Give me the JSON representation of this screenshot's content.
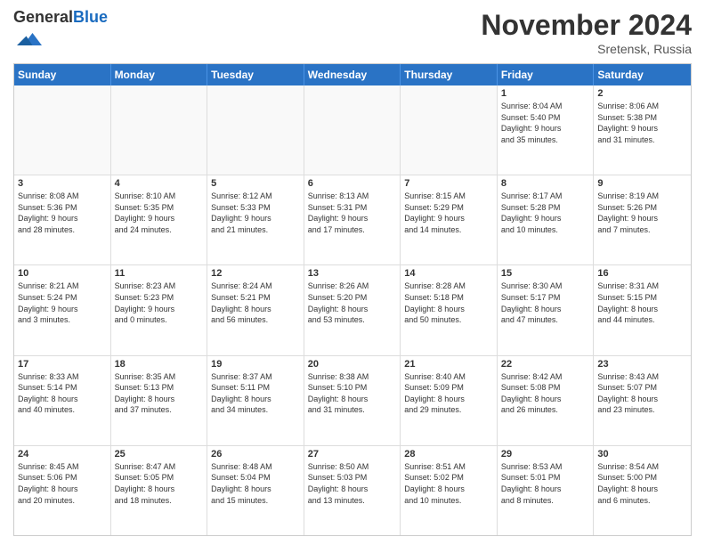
{
  "logo": {
    "general": "General",
    "blue": "Blue"
  },
  "header": {
    "month": "November 2024",
    "location": "Sretensk, Russia"
  },
  "weekdays": [
    "Sunday",
    "Monday",
    "Tuesday",
    "Wednesday",
    "Thursday",
    "Friday",
    "Saturday"
  ],
  "rows": [
    [
      {
        "day": "",
        "empty": true
      },
      {
        "day": "",
        "empty": true
      },
      {
        "day": "",
        "empty": true
      },
      {
        "day": "",
        "empty": true
      },
      {
        "day": "",
        "empty": true
      },
      {
        "day": "1",
        "lines": [
          "Sunrise: 8:04 AM",
          "Sunset: 5:40 PM",
          "Daylight: 9 hours",
          "and 35 minutes."
        ]
      },
      {
        "day": "2",
        "lines": [
          "Sunrise: 8:06 AM",
          "Sunset: 5:38 PM",
          "Daylight: 9 hours",
          "and 31 minutes."
        ]
      }
    ],
    [
      {
        "day": "3",
        "lines": [
          "Sunrise: 8:08 AM",
          "Sunset: 5:36 PM",
          "Daylight: 9 hours",
          "and 28 minutes."
        ]
      },
      {
        "day": "4",
        "lines": [
          "Sunrise: 8:10 AM",
          "Sunset: 5:35 PM",
          "Daylight: 9 hours",
          "and 24 minutes."
        ]
      },
      {
        "day": "5",
        "lines": [
          "Sunrise: 8:12 AM",
          "Sunset: 5:33 PM",
          "Daylight: 9 hours",
          "and 21 minutes."
        ]
      },
      {
        "day": "6",
        "lines": [
          "Sunrise: 8:13 AM",
          "Sunset: 5:31 PM",
          "Daylight: 9 hours",
          "and 17 minutes."
        ]
      },
      {
        "day": "7",
        "lines": [
          "Sunrise: 8:15 AM",
          "Sunset: 5:29 PM",
          "Daylight: 9 hours",
          "and 14 minutes."
        ]
      },
      {
        "day": "8",
        "lines": [
          "Sunrise: 8:17 AM",
          "Sunset: 5:28 PM",
          "Daylight: 9 hours",
          "and 10 minutes."
        ]
      },
      {
        "day": "9",
        "lines": [
          "Sunrise: 8:19 AM",
          "Sunset: 5:26 PM",
          "Daylight: 9 hours",
          "and 7 minutes."
        ]
      }
    ],
    [
      {
        "day": "10",
        "lines": [
          "Sunrise: 8:21 AM",
          "Sunset: 5:24 PM",
          "Daylight: 9 hours",
          "and 3 minutes."
        ]
      },
      {
        "day": "11",
        "lines": [
          "Sunrise: 8:23 AM",
          "Sunset: 5:23 PM",
          "Daylight: 9 hours",
          "and 0 minutes."
        ]
      },
      {
        "day": "12",
        "lines": [
          "Sunrise: 8:24 AM",
          "Sunset: 5:21 PM",
          "Daylight: 8 hours",
          "and 56 minutes."
        ]
      },
      {
        "day": "13",
        "lines": [
          "Sunrise: 8:26 AM",
          "Sunset: 5:20 PM",
          "Daylight: 8 hours",
          "and 53 minutes."
        ]
      },
      {
        "day": "14",
        "lines": [
          "Sunrise: 8:28 AM",
          "Sunset: 5:18 PM",
          "Daylight: 8 hours",
          "and 50 minutes."
        ]
      },
      {
        "day": "15",
        "lines": [
          "Sunrise: 8:30 AM",
          "Sunset: 5:17 PM",
          "Daylight: 8 hours",
          "and 47 minutes."
        ]
      },
      {
        "day": "16",
        "lines": [
          "Sunrise: 8:31 AM",
          "Sunset: 5:15 PM",
          "Daylight: 8 hours",
          "and 44 minutes."
        ]
      }
    ],
    [
      {
        "day": "17",
        "lines": [
          "Sunrise: 8:33 AM",
          "Sunset: 5:14 PM",
          "Daylight: 8 hours",
          "and 40 minutes."
        ]
      },
      {
        "day": "18",
        "lines": [
          "Sunrise: 8:35 AM",
          "Sunset: 5:13 PM",
          "Daylight: 8 hours",
          "and 37 minutes."
        ]
      },
      {
        "day": "19",
        "lines": [
          "Sunrise: 8:37 AM",
          "Sunset: 5:11 PM",
          "Daylight: 8 hours",
          "and 34 minutes."
        ]
      },
      {
        "day": "20",
        "lines": [
          "Sunrise: 8:38 AM",
          "Sunset: 5:10 PM",
          "Daylight: 8 hours",
          "and 31 minutes."
        ]
      },
      {
        "day": "21",
        "lines": [
          "Sunrise: 8:40 AM",
          "Sunset: 5:09 PM",
          "Daylight: 8 hours",
          "and 29 minutes."
        ]
      },
      {
        "day": "22",
        "lines": [
          "Sunrise: 8:42 AM",
          "Sunset: 5:08 PM",
          "Daylight: 8 hours",
          "and 26 minutes."
        ]
      },
      {
        "day": "23",
        "lines": [
          "Sunrise: 8:43 AM",
          "Sunset: 5:07 PM",
          "Daylight: 8 hours",
          "and 23 minutes."
        ]
      }
    ],
    [
      {
        "day": "24",
        "lines": [
          "Sunrise: 8:45 AM",
          "Sunset: 5:06 PM",
          "Daylight: 8 hours",
          "and 20 minutes."
        ]
      },
      {
        "day": "25",
        "lines": [
          "Sunrise: 8:47 AM",
          "Sunset: 5:05 PM",
          "Daylight: 8 hours",
          "and 18 minutes."
        ]
      },
      {
        "day": "26",
        "lines": [
          "Sunrise: 8:48 AM",
          "Sunset: 5:04 PM",
          "Daylight: 8 hours",
          "and 15 minutes."
        ]
      },
      {
        "day": "27",
        "lines": [
          "Sunrise: 8:50 AM",
          "Sunset: 5:03 PM",
          "Daylight: 8 hours",
          "and 13 minutes."
        ]
      },
      {
        "day": "28",
        "lines": [
          "Sunrise: 8:51 AM",
          "Sunset: 5:02 PM",
          "Daylight: 8 hours",
          "and 10 minutes."
        ]
      },
      {
        "day": "29",
        "lines": [
          "Sunrise: 8:53 AM",
          "Sunset: 5:01 PM",
          "Daylight: 8 hours",
          "and 8 minutes."
        ]
      },
      {
        "day": "30",
        "lines": [
          "Sunrise: 8:54 AM",
          "Sunset: 5:00 PM",
          "Daylight: 8 hours",
          "and 6 minutes."
        ]
      }
    ]
  ]
}
